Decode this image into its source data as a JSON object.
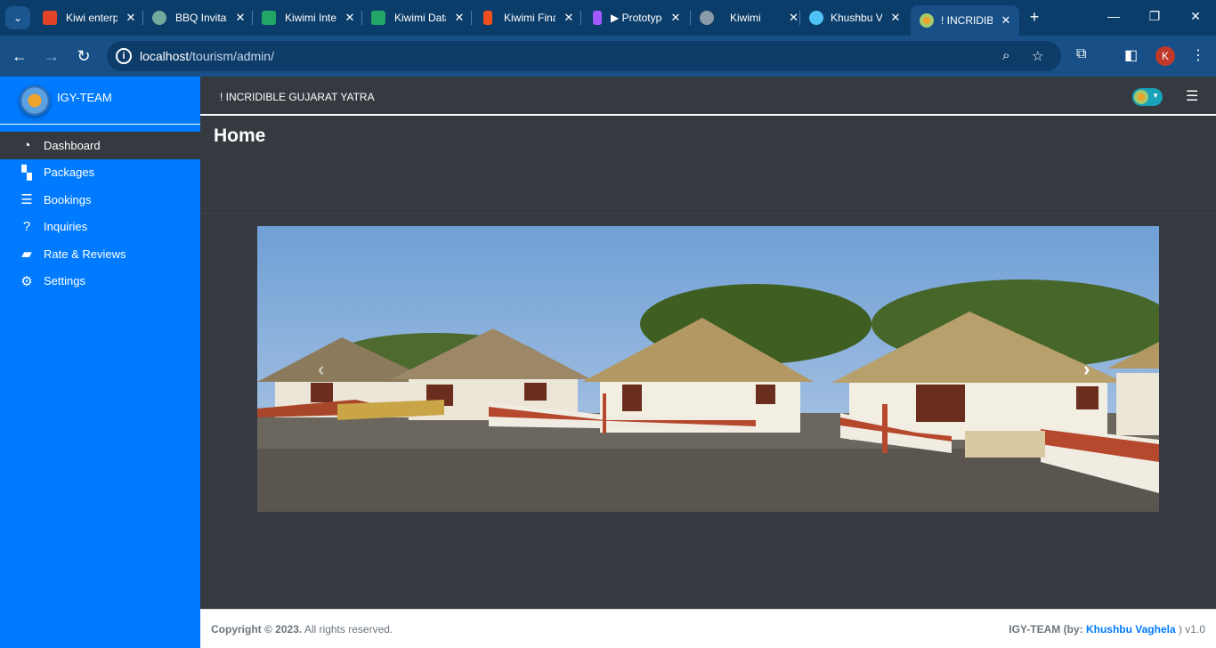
{
  "browser": {
    "tabs": [
      {
        "title": "Kiwi enterprise",
        "icon": "gitlab-icon",
        "color": "#e24329"
      },
      {
        "title": "BBQ Invitation",
        "icon": "chatgpt-icon",
        "color": "#74aa9c"
      },
      {
        "title": "Kiwimi Internal",
        "icon": "sheets-icon",
        "color": "#23a566"
      },
      {
        "title": "Kiwimi Data",
        "icon": "sheets-icon",
        "color": "#23a566"
      },
      {
        "title": "Kiwimi Final",
        "icon": "figma-icon",
        "color": "#f24e1e"
      },
      {
        "title": "▶ Prototype",
        "icon": "figma-icon",
        "color": "#a259ff"
      },
      {
        "title": "Kiwimi",
        "icon": "globe-icon",
        "color": "#8a9aa8"
      },
      {
        "title": "Khushbu Vaghela",
        "icon": "cloud-icon",
        "color": "#4fc3f7"
      },
      {
        "title": "! INCRIDIBLE",
        "icon": "site-logo-icon",
        "color": "#f0a32a"
      }
    ],
    "url_host": "localhost",
    "url_path": "/tourism/admin/",
    "profile_initial": "K"
  },
  "sidebar": {
    "brand": "IGY-TEAM",
    "items": [
      {
        "label": "Dashboard",
        "icon": "dashboard-icon"
      },
      {
        "label": "Packages",
        "icon": "map-icon"
      },
      {
        "label": "Bookings",
        "icon": "list-icon"
      },
      {
        "label": "Inquiries",
        "icon": "question-icon"
      },
      {
        "label": "Rate & Reviews",
        "icon": "comment-icon"
      },
      {
        "label": "Settings",
        "icon": "gears-icon"
      }
    ]
  },
  "header": {
    "site_title": "! INCRIDIBLE GUJARAT YATRA"
  },
  "content": {
    "page_title": "Home"
  },
  "footer": {
    "copyright": "Copyright © 2023.",
    "rights": " All rights reserved.",
    "team": "IGY-TEAM (by: ",
    "author": "Khushbu Vaghela",
    "version": " ) v1.0"
  }
}
